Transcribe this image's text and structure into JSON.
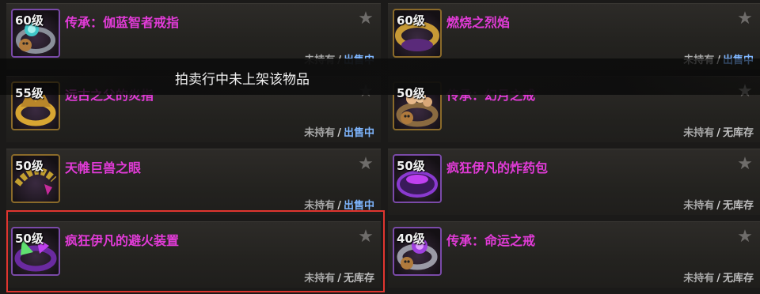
{
  "items": [
    {
      "level": "60级",
      "name": "传承：伽蓝智者戒指",
      "own": "未持有",
      "sep": "/",
      "stock": "出售中",
      "stock_type": "sale",
      "icon": "ring-icon"
    },
    {
      "level": "60级",
      "name": "燃烧之烈焰",
      "own": "未持有",
      "sep": "/",
      "stock": "出售中",
      "stock_type": "sale",
      "icon": "ring-icon"
    },
    {
      "level": "55级",
      "name": "远古之父的炎指",
      "own": "未持有",
      "sep": "/",
      "stock": "出售中",
      "stock_type": "sale",
      "icon": "ring-icon"
    },
    {
      "level": "50级",
      "name": "传承：幻月之戒",
      "own": "未持有",
      "sep": "/",
      "stock": "无库存",
      "stock_type": "none",
      "icon": "ring-icon"
    },
    {
      "level": "50级",
      "name": "天帷巨兽之眼",
      "own": "未持有",
      "sep": "/",
      "stock": "出售中",
      "stock_type": "sale",
      "icon": "ring-icon"
    },
    {
      "level": "50级",
      "name": "疯狂伊凡的炸药包",
      "own": "未持有",
      "sep": "/",
      "stock": "无库存",
      "stock_type": "none",
      "icon": "ring-icon"
    },
    {
      "level": "50级",
      "name": "疯狂伊凡的避火装置",
      "own": "未持有",
      "sep": "/",
      "stock": "无库存",
      "stock_type": "none",
      "icon": "ring-icon"
    },
    {
      "level": "40级",
      "name": "传承：命运之戒",
      "own": "未持有",
      "sep": "/",
      "stock": "无库存",
      "stock_type": "none",
      "icon": "ring-icon"
    }
  ],
  "toast": {
    "message": "拍卖行中未上架该物品"
  },
  "star_icon": "star-icon",
  "colors": {
    "item_name": "#e23bd8",
    "sale": "#7fb6ff",
    "selection": "#e0352f"
  }
}
